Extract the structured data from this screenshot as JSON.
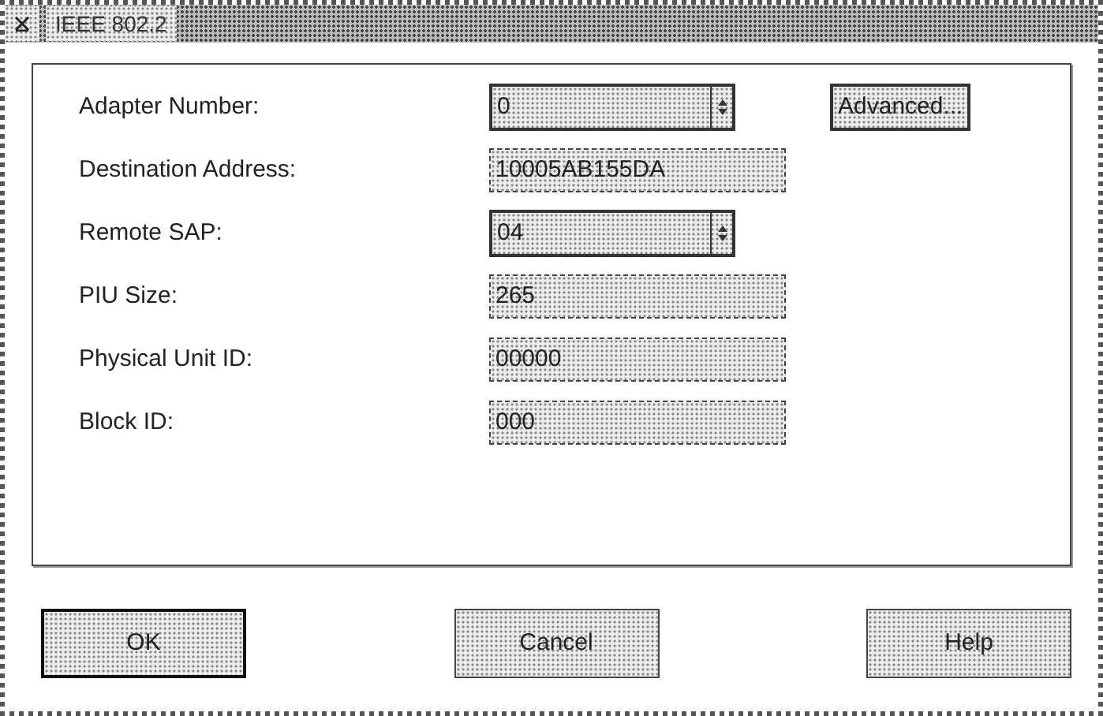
{
  "window": {
    "title": "IEEE 802.2"
  },
  "fields": [
    {
      "label": "Adapter Number:",
      "kind": "combo",
      "value": "0"
    },
    {
      "label": "Destination Address:",
      "kind": "entry",
      "value": "10005AB155DA"
    },
    {
      "label": "Remote SAP:",
      "kind": "combo",
      "value": "04"
    },
    {
      "label": "PIU Size:",
      "kind": "entry",
      "value": "265"
    },
    {
      "label": "Physical Unit ID:",
      "kind": "entry",
      "value": "00000"
    },
    {
      "label": "Block ID:",
      "kind": "entry",
      "value": "000"
    }
  ],
  "advanced_button": "Advanced...",
  "buttons": [
    {
      "label": "OK",
      "default": true
    },
    {
      "label": "Cancel",
      "default": false
    },
    {
      "label": "Help",
      "default": false
    }
  ]
}
